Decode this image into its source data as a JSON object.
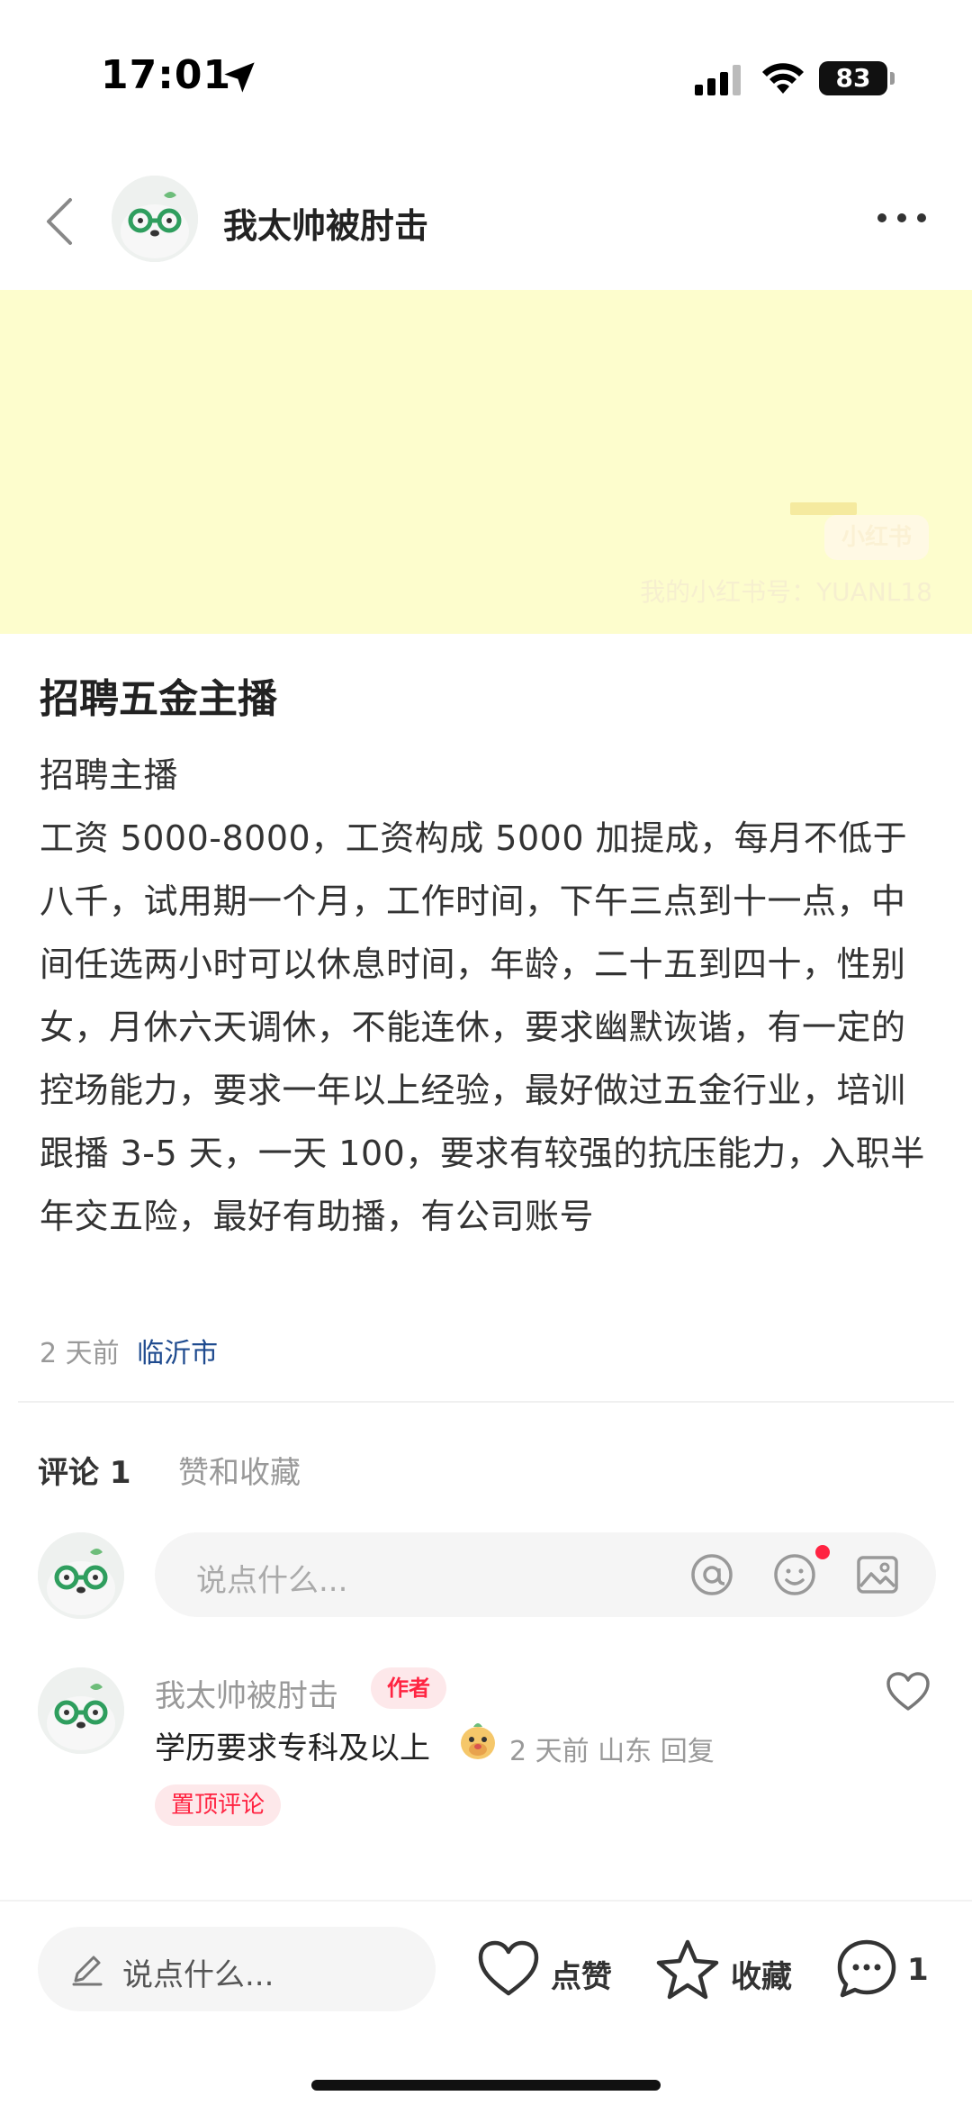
{
  "status_bar": {
    "time": "17:01",
    "battery": "83"
  },
  "header": {
    "author_name": "我太帅被肘击"
  },
  "banner": {
    "background": "#fdfdcd",
    "watermark_logo": "小红书",
    "watermark_id": "我的小红书号：YUANL18"
  },
  "post": {
    "title": "招聘五金主播",
    "body": "招聘主播\n工资 5000-8000，工资构成 5000 加提成，每月不低于八千，试用期一个月，工作时间，下午三点到十一点，中间任选两小时可以休息时间，年龄，二十五到四十，性别女，月休六天调休，不能连休，要求幽默诙谐，有一定的控场能力，要求一年以上经验，最好做过五金行业，培训跟播 3-5 天，一天 100，要求有较强的抗压能力，入职半年交五险，最好有助播，有公司账号",
    "time_ago": "2 天前",
    "location": "临沂市"
  },
  "tabs": {
    "comments": "评论 1",
    "likes_favs": "赞和收藏"
  },
  "comment_input": {
    "placeholder": "说点什么..."
  },
  "comments": [
    {
      "name": "我太帅被肘击",
      "badge": "作者",
      "text": "学历要求专科及以上",
      "meta": "2 天前  山东  回复",
      "pinned": "置顶评论"
    }
  ],
  "bottom_bar": {
    "input_placeholder": "说点什么...",
    "like_label": "点赞",
    "fav_label": "收藏",
    "comment_count": "1"
  },
  "colors": {
    "accent": "#ff2442",
    "location_link": "#1f4b8f"
  }
}
